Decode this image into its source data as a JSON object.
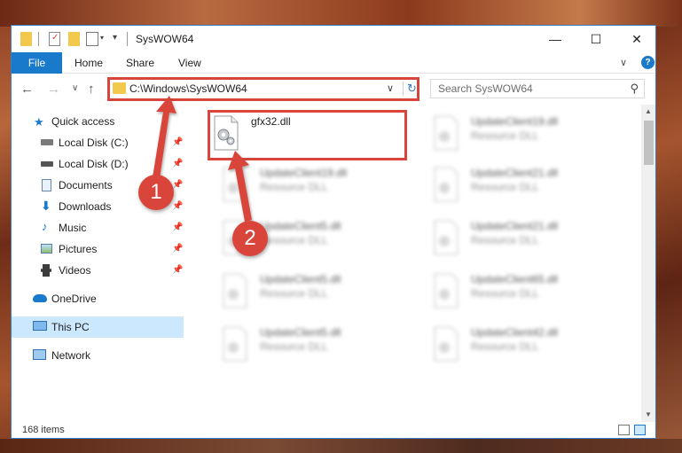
{
  "window": {
    "title": "SysWOW64",
    "minimize": "—",
    "maximize": "☐",
    "close": "✕"
  },
  "ribbon": {
    "tabs": [
      "File",
      "Home",
      "Share",
      "View"
    ],
    "collapse": "∨",
    "help": "?"
  },
  "navigation": {
    "back": "←",
    "forward": "→",
    "recent": "∨",
    "up": "↑",
    "address": "C:\\Windows\\SysWOW64",
    "address_dropdown": "∨",
    "refresh": "↻",
    "search_placeholder": "Search SysWOW64"
  },
  "sidebar": {
    "items": [
      {
        "label": "Quick access",
        "icon": "star-icon"
      },
      {
        "label": "Local Disk (C:)",
        "icon": "drive-icon",
        "pinned": true
      },
      {
        "label": "Local Disk (D:)",
        "icon": "drive-icon",
        "pinned": true
      },
      {
        "label": "Documents",
        "icon": "documents-icon",
        "pinned": true
      },
      {
        "label": "Downloads",
        "icon": "download-icon",
        "pinned": true
      },
      {
        "label": "Music",
        "icon": "music-icon",
        "pinned": true
      },
      {
        "label": "Pictures",
        "icon": "pictures-icon",
        "pinned": true
      },
      {
        "label": "Videos",
        "icon": "videos-icon",
        "pinned": true
      },
      {
        "label": "OneDrive",
        "icon": "cloud-icon"
      },
      {
        "label": "This PC",
        "icon": "computer-icon",
        "selected": true
      },
      {
        "label": "Network",
        "icon": "network-icon"
      }
    ]
  },
  "files": [
    {
      "name": "gfx32.dll",
      "type": "",
      "highlighted": true
    },
    {
      "name": "UpdateClient19.dll",
      "type": "Resource DLL"
    },
    {
      "name": "UpdateClient19.dll",
      "type": "Resource DLL"
    },
    {
      "name": "UpdateClient21.dll",
      "type": "Resource DLL"
    },
    {
      "name": "UpdateClient5.dll",
      "type": "Resource DLL"
    },
    {
      "name": "UpdateClient21.dll",
      "type": "Resource DLL"
    },
    {
      "name": "UpdateClient5.dll",
      "type": "Resource DLL"
    },
    {
      "name": "UpdateClient65.dll",
      "type": "Resource DLL"
    },
    {
      "name": "UpdateClient5.dll",
      "type": "Resource DLL"
    },
    {
      "name": "UpdateClient42.dll",
      "type": "Resource DLL"
    }
  ],
  "status": {
    "item_count": "168 items"
  },
  "callouts": [
    "1",
    "2"
  ],
  "colors": {
    "accent": "#1979ca",
    "callout_red": "#d9453b",
    "selected_bg": "#cce8ff"
  }
}
